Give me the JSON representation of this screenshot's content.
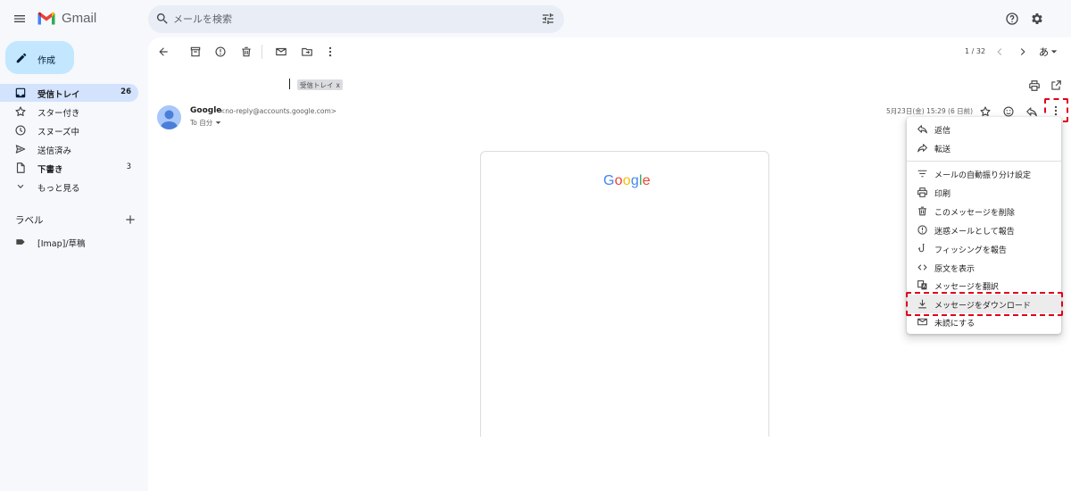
{
  "header": {
    "app_name": "Gmail",
    "search_placeholder": "メールを検索"
  },
  "sidebar": {
    "compose_label": "作成",
    "items": [
      {
        "label": "受信トレイ",
        "count": "26",
        "icon": "inbox-icon",
        "active": true
      },
      {
        "label": "スター付き",
        "count": "",
        "icon": "star-icon"
      },
      {
        "label": "スヌーズ中",
        "count": "",
        "icon": "clock-icon"
      },
      {
        "label": "送信済み",
        "count": "",
        "icon": "send-icon"
      },
      {
        "label": "下書き",
        "count": "3",
        "icon": "draft-icon",
        "bold": true
      },
      {
        "label": "もっと見る",
        "count": "",
        "icon": "chevron-down-icon"
      }
    ],
    "labels_title": "ラベル",
    "labels": [
      {
        "label": "[Imap]/草稿",
        "icon": "label-icon"
      }
    ]
  },
  "toolbar": {
    "pager": "1 / 32",
    "input_tool": "あ"
  },
  "message": {
    "tag": "受信トレイ",
    "tag_close": "x",
    "sender_name": "Google",
    "sender_email": "<no-reply@accounts.google.com>",
    "to": "To 自分",
    "date": "5月23日(金) 15:29 (6 日前)"
  },
  "email_body": {
    "logo_letters": [
      {
        "ch": "G",
        "color": "#4285F4"
      },
      {
        "ch": "o",
        "color": "#EA4335"
      },
      {
        "ch": "o",
        "color": "#FBBC05"
      },
      {
        "ch": "g",
        "color": "#4285F4"
      },
      {
        "ch": "l",
        "color": "#34A853"
      },
      {
        "ch": "e",
        "color": "#EA4335"
      }
    ]
  },
  "menu": {
    "items": [
      {
        "label": "返信",
        "icon": "reply-icon"
      },
      {
        "label": "転送",
        "icon": "forward-icon"
      },
      {
        "label": "メールの自動振り分け設定",
        "icon": "filter-icon"
      },
      {
        "label": "印刷",
        "icon": "print-icon"
      },
      {
        "label": "このメッセージを削除",
        "icon": "trash-icon"
      },
      {
        "label": "迷惑メールとして報告",
        "icon": "spam-icon"
      },
      {
        "label": "フィッシングを報告",
        "icon": "phishing-hook-icon"
      },
      {
        "label": "原文を表示",
        "icon": "code-icon"
      },
      {
        "label": "メッセージを翻訳",
        "icon": "translate-icon"
      },
      {
        "label": "メッセージをダウンロード",
        "icon": "download-icon",
        "highlighted": true
      },
      {
        "label": "未読にする",
        "icon": "mark-unread-icon"
      }
    ]
  },
  "colors": {
    "accent": "#c2e7ff",
    "active_nav": "#d3e3fd",
    "highlight_border": "#e0001b"
  }
}
